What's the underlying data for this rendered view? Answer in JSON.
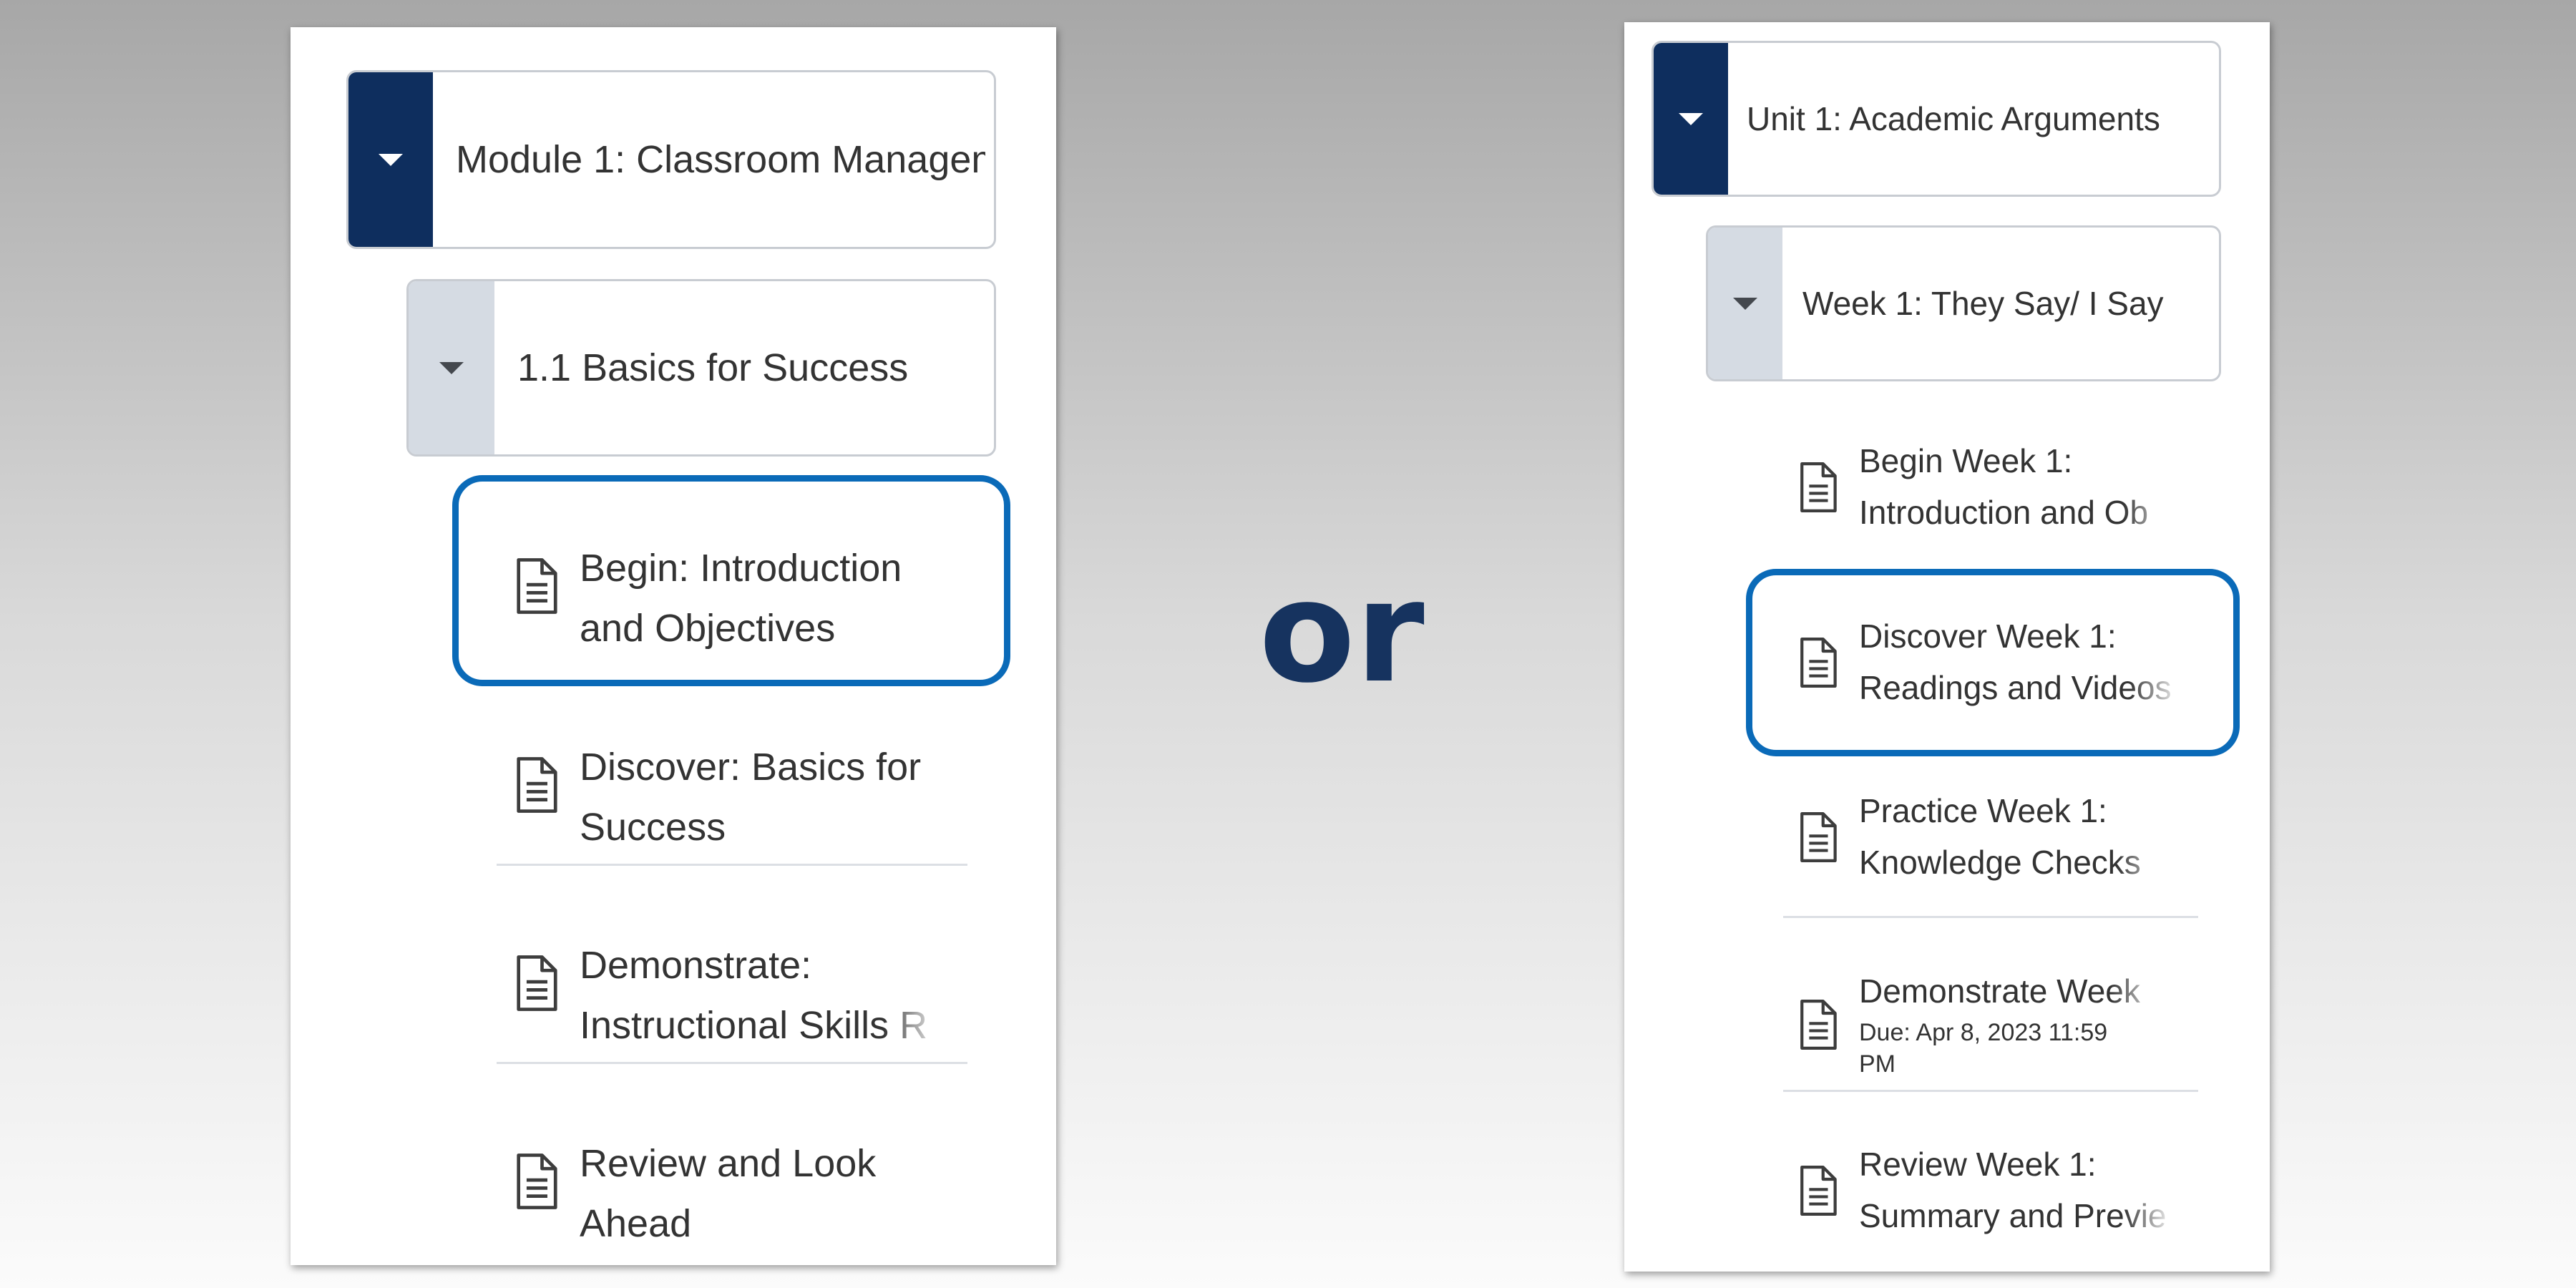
{
  "left_panel": {
    "module": {
      "title_line1": "Module 1: Classroom",
      "title_line2": "Management Part I"
    },
    "section": {
      "title": "1.1 Basics for Success"
    },
    "items": [
      {
        "line1": "Begin: Introduction",
        "line2": "and Objectives",
        "icon": "document-icon",
        "highlighted": true
      },
      {
        "line1": "Discover: Basics for",
        "line2": "Success",
        "icon": "document-icon"
      },
      {
        "line1": "Demonstrate:",
        "line2": "Instructional Skills R",
        "icon": "document-icon"
      },
      {
        "line1": "Review and Look",
        "line2": "Ahead",
        "icon": "document-icon"
      }
    ]
  },
  "separator_word": "or",
  "right_panel": {
    "unit": {
      "title": "Unit 1: Academic Arguments"
    },
    "week": {
      "title": "Week 1: They Say/ I Say"
    },
    "items": [
      {
        "line1": "Begin Week 1:",
        "line2": "Introduction and Ob",
        "icon": "document-icon"
      },
      {
        "line1": "Discover Week 1:",
        "line2": "Readings and Videos",
        "icon": "document-icon",
        "highlighted": true
      },
      {
        "line1": "Practice Week 1:",
        "line2": "Knowledge Checks",
        "icon": "document-icon"
      },
      {
        "line1": "Demonstrate Week",
        "due_line1": "Due: Apr 8, 2023 11:59",
        "due_line2": "PM",
        "icon": "document-icon"
      },
      {
        "line1": "Review Week 1:",
        "line2": "Summary and Previe",
        "icon": "document-icon"
      }
    ]
  },
  "colors": {
    "highlight": "#0a6ab8",
    "toggle_dark": "#0e2e5e",
    "toggle_light": "#d5dbe3",
    "or_text": "#16335f"
  }
}
